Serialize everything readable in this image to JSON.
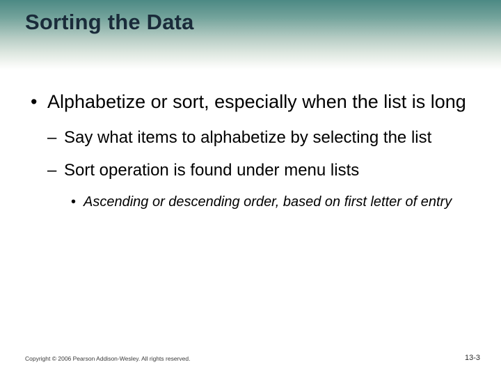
{
  "title": "Sorting the Data",
  "bullets": {
    "main": "Alphabetize or sort, especially when the list is long",
    "sub1": "Say what items to alphabetize by selecting the list",
    "sub2": "Sort operation is found under menu lists",
    "subsub": "Ascending or descending order, based on first letter of entry"
  },
  "footer": {
    "copyright": "Copyright © 2006 Pearson Addison-Wesley. All rights reserved.",
    "page": "13-3"
  }
}
